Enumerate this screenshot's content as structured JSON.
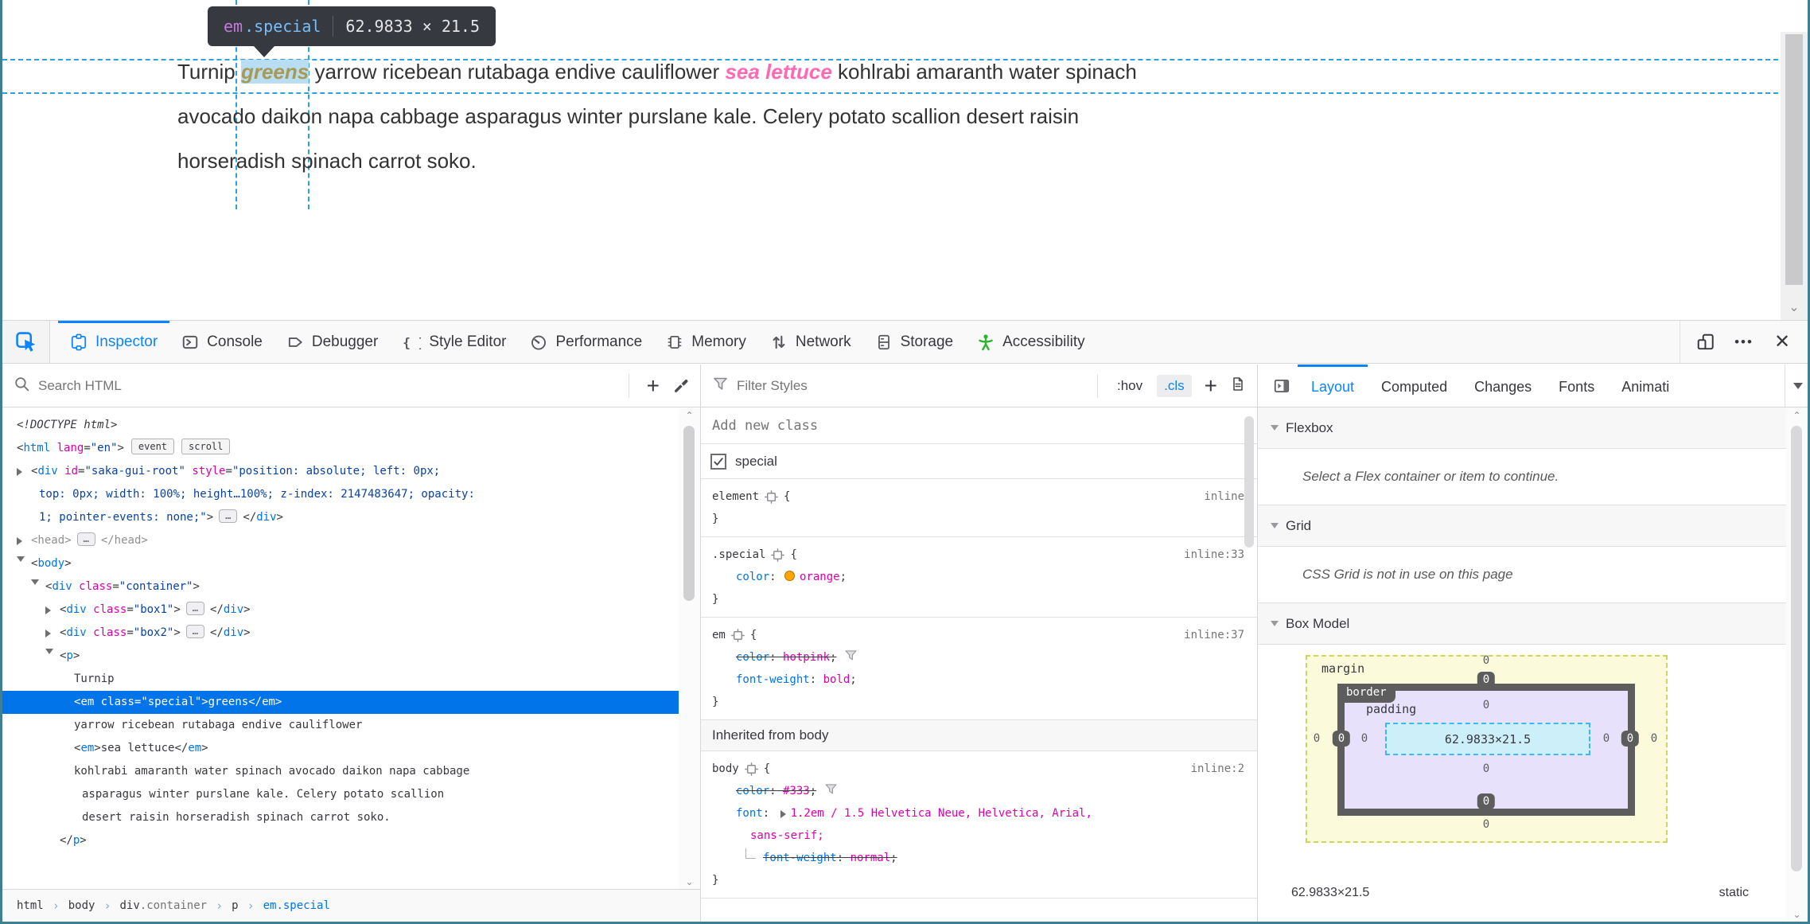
{
  "tooltip": {
    "tag": "em",
    "cls": ".special",
    "dims": "62.9833 × 21.5"
  },
  "page": {
    "lines": [
      {
        "parts": [
          {
            "t": "Turnip ",
            "s": "plain"
          },
          {
            "t": "greens",
            "s": "em-special"
          },
          {
            "t": " yarrow ricebean rutabaga endive cauliflower ",
            "s": "plain"
          },
          {
            "t": "sea lettuce",
            "s": "em"
          },
          {
            "t": " kohlrabi amaranth water spinach",
            "s": "plain"
          }
        ]
      },
      {
        "parts": [
          {
            "t": "avocado daikon napa cabbage asparagus winter purslane kale. Celery potato scallion desert raisin",
            "s": "plain"
          }
        ]
      },
      {
        "parts": [
          {
            "t": "horseradish spinach carrot soko.",
            "s": "plain"
          }
        ]
      }
    ]
  },
  "devtools": {
    "toolbar": {
      "tabs": [
        {
          "id": "inspector",
          "label": "Inspector",
          "active": true
        },
        {
          "id": "console",
          "label": "Console"
        },
        {
          "id": "debugger",
          "label": "Debugger"
        },
        {
          "id": "style-editor",
          "label": "Style Editor"
        },
        {
          "id": "performance",
          "label": "Performance"
        },
        {
          "id": "memory",
          "label": "Memory"
        },
        {
          "id": "network",
          "label": "Network"
        },
        {
          "id": "storage",
          "label": "Storage"
        },
        {
          "id": "accessibility",
          "label": "Accessibility"
        }
      ],
      "right_icons": [
        "responsive-design-mode",
        "meatball-menu",
        "close"
      ]
    },
    "markup": {
      "search_placeholder": "Search HTML",
      "tree": [
        {
          "i": 0,
          "p": [
            [
              "<!DOCTYPE html>",
              "dt"
            ]
          ]
        },
        {
          "i": 0,
          "p": [
            [
              "<",
              "n"
            ],
            [
              "html",
              "t"
            ],
            [
              " ",
              "n"
            ],
            [
              "lang",
              "a"
            ],
            [
              "=",
              "n"
            ],
            [
              "\"en\"",
              "v"
            ],
            [
              ">",
              "n"
            ],
            [
              "event",
              "b"
            ],
            [
              "scroll",
              "b"
            ]
          ]
        },
        {
          "i": 1,
          "a": "r",
          "p": [
            [
              "<",
              "n"
            ],
            [
              "div",
              "t"
            ],
            [
              " ",
              "n"
            ],
            [
              "id",
              "a"
            ],
            [
              "=",
              "n"
            ],
            [
              "\"saka-gui-root\"",
              "v"
            ],
            [
              " ",
              "n"
            ],
            [
              "style",
              "a"
            ],
            [
              "=",
              "n"
            ],
            [
              "\"position: absolute; left: 0px;",
              "v"
            ]
          ]
        },
        {
          "i": 1,
          "cont": 1,
          "p": [
            [
              "top: 0px; width: 100%; height…100%; z-index: 2147483647; opacity:",
              "v"
            ]
          ]
        },
        {
          "i": 1,
          "cont": 1,
          "p": [
            [
              "1; pointer-events: none;\"",
              "v"
            ],
            [
              ">",
              "n"
            ],
            [
              "…",
              "e"
            ],
            [
              "</",
              "n"
            ],
            [
              "div",
              "t"
            ],
            [
              ">",
              "n"
            ]
          ]
        },
        {
          "i": 1,
          "a": "r",
          "p": [
            [
              "<head>",
              "d"
            ],
            [
              "…",
              "e"
            ],
            [
              "</head>",
              "d"
            ]
          ]
        },
        {
          "i": 1,
          "a": "d",
          "p": [
            [
              "<",
              "n"
            ],
            [
              "body",
              "t"
            ],
            [
              ">",
              "n"
            ]
          ]
        },
        {
          "i": 2,
          "a": "d",
          "p": [
            [
              "<",
              "n"
            ],
            [
              "div",
              "t"
            ],
            [
              " ",
              "n"
            ],
            [
              "class",
              "a"
            ],
            [
              "=",
              "n"
            ],
            [
              "\"container\"",
              "v"
            ],
            [
              ">",
              "n"
            ]
          ]
        },
        {
          "i": 3,
          "a": "r",
          "p": [
            [
              "<",
              "n"
            ],
            [
              "div",
              "t"
            ],
            [
              " ",
              "n"
            ],
            [
              "class",
              "a"
            ],
            [
              "=",
              "n"
            ],
            [
              "\"box1\"",
              "v"
            ],
            [
              ">",
              "n"
            ],
            [
              "…",
              "e"
            ],
            [
              "</",
              "n"
            ],
            [
              "div",
              "t"
            ],
            [
              ">",
              "n"
            ]
          ]
        },
        {
          "i": 3,
          "a": "r",
          "p": [
            [
              "<",
              "n"
            ],
            [
              "div",
              "t"
            ],
            [
              " ",
              "n"
            ],
            [
              "class",
              "a"
            ],
            [
              "=",
              "n"
            ],
            [
              "\"box2\"",
              "v"
            ],
            [
              ">",
              "n"
            ],
            [
              "…",
              "e"
            ],
            [
              "</",
              "n"
            ],
            [
              "div",
              "t"
            ],
            [
              ">",
              "n"
            ]
          ]
        },
        {
          "i": 3,
          "a": "d",
          "p": [
            [
              "<",
              "n"
            ],
            [
              "p",
              "t"
            ],
            [
              ">",
              "n"
            ]
          ]
        },
        {
          "i": 4,
          "p": [
            [
              "Turnip",
              "n"
            ]
          ]
        },
        {
          "i": 4,
          "sel": 1,
          "p": [
            [
              "<",
              "n"
            ],
            [
              "em",
              "t"
            ],
            [
              " ",
              "n"
            ],
            [
              "class",
              "a"
            ],
            [
              "=",
              "n"
            ],
            [
              "\"special\"",
              "v"
            ],
            [
              ">",
              "n"
            ],
            [
              "greens",
              "n"
            ],
            [
              "</",
              "n"
            ],
            [
              "em",
              "t"
            ],
            [
              ">",
              "n"
            ]
          ]
        },
        {
          "i": 4,
          "p": [
            [
              "yarrow ricebean rutabaga endive cauliflower",
              "n"
            ]
          ]
        },
        {
          "i": 4,
          "p": [
            [
              "<",
              "n"
            ],
            [
              "em",
              "t"
            ],
            [
              ">",
              "n"
            ],
            [
              "sea lettuce",
              "n"
            ],
            [
              "</",
              "n"
            ],
            [
              "em",
              "t"
            ],
            [
              ">",
              "n"
            ]
          ]
        },
        {
          "i": 4,
          "p": [
            [
              "kohlrabi amaranth water spinach avocado daikon napa cabbage",
              "n"
            ]
          ]
        },
        {
          "i": 4,
          "cont": 1,
          "p": [
            [
              "asparagus winter purslane kale. Celery potato scallion",
              "n"
            ]
          ]
        },
        {
          "i": 4,
          "cont": 1,
          "p": [
            [
              "desert raisin horseradish spinach carrot soko.",
              "n"
            ]
          ]
        },
        {
          "i": 3,
          "p": [
            [
              "</",
              "n"
            ],
            [
              "p",
              "t"
            ],
            [
              ">",
              "n"
            ]
          ]
        }
      ],
      "breadcrumb": [
        {
          "tag": "html"
        },
        {
          "tag": "body"
        },
        {
          "tag": "div",
          "suffix": ".container"
        },
        {
          "tag": "p"
        },
        {
          "tag": "em",
          "suffix": ".special",
          "selected": true
        }
      ]
    },
    "rules": {
      "filter_placeholder": "Filter Styles",
      "pseudo_button": ":hov",
      "class_button": ".cls",
      "add_class_placeholder": "Add new class",
      "class_checkbox": {
        "label": "special",
        "checked": true
      },
      "rules": [
        {
          "selector": "element",
          "loc": "inline",
          "decls": []
        },
        {
          "selector": ".special",
          "loc": "inline:33",
          "decls": [
            {
              "prop": "color",
              "value": "orange",
              "swatch": "#ffa500"
            }
          ]
        },
        {
          "selector": "em",
          "loc": "inline:37",
          "decls": [
            {
              "prop": "color",
              "value": "hotpink",
              "struck": true,
              "funnel": true
            },
            {
              "prop": "font-weight",
              "value": "bold"
            }
          ]
        },
        {
          "inherited": "Inherited from body"
        },
        {
          "selector": "body",
          "loc": "inline:2",
          "decls": [
            {
              "prop": "color",
              "value": "#333",
              "struck": true,
              "funnel": true
            },
            {
              "prop": "font",
              "value": "1.2em / 1.5 Helvetica Neue, Helvetica, Arial,",
              "expand": true
            },
            {
              "cont": "sans-serif;"
            },
            {
              "prop": "font-weight",
              "value": "normal",
              "struck": true,
              "elbow": true
            }
          ]
        }
      ]
    },
    "layout": {
      "tabs": [
        {
          "label": "Layout",
          "active": true
        },
        {
          "label": "Computed"
        },
        {
          "label": "Changes"
        },
        {
          "label": "Fonts"
        },
        {
          "label": "Animati"
        }
      ],
      "flexbox": {
        "title": "Flexbox",
        "message": "Select a Flex container or item to continue."
      },
      "grid": {
        "title": "Grid",
        "message": "CSS Grid is not in use on this page"
      },
      "box_model": {
        "title": "Box Model",
        "labels": {
          "margin": "margin",
          "border": "border",
          "padding": "padding"
        },
        "content": "62.9833×21.5",
        "values": {
          "margin": {
            "top": "0",
            "right": "0",
            "bottom": "0",
            "left": "0"
          },
          "border": {
            "top": "0",
            "right": "0",
            "bottom": "0",
            "left": "0"
          },
          "padding": {
            "top": "0",
            "right": "0",
            "bottom": "0",
            "left": "0"
          }
        },
        "footer_dimensions": "62.9833×21.5",
        "footer_position": "static"
      }
    }
  },
  "colors": {
    "accent": "#0a84ff",
    "selection": "#0074e8",
    "tag": "#0074e8",
    "attribute": "#dd00a9",
    "attr_value": "#0842a4",
    "css_property": "#0074e8",
    "css_value": "#dd00a9",
    "hotpink_text": "#ff69b4",
    "orange_swatch": "#ffa500",
    "accessibility_green": "#2cb52c",
    "margin_fill": "#fbfbdc",
    "padding_fill": "#e7e1fb",
    "content_fill": "#cdeffa",
    "border_fill": "#5d5d5d",
    "highlight_fill": "#b9ddf3",
    "guide_blue": "#2da0e0",
    "tooltip_bg": "#36393f",
    "window_border": "#3e7f93"
  }
}
